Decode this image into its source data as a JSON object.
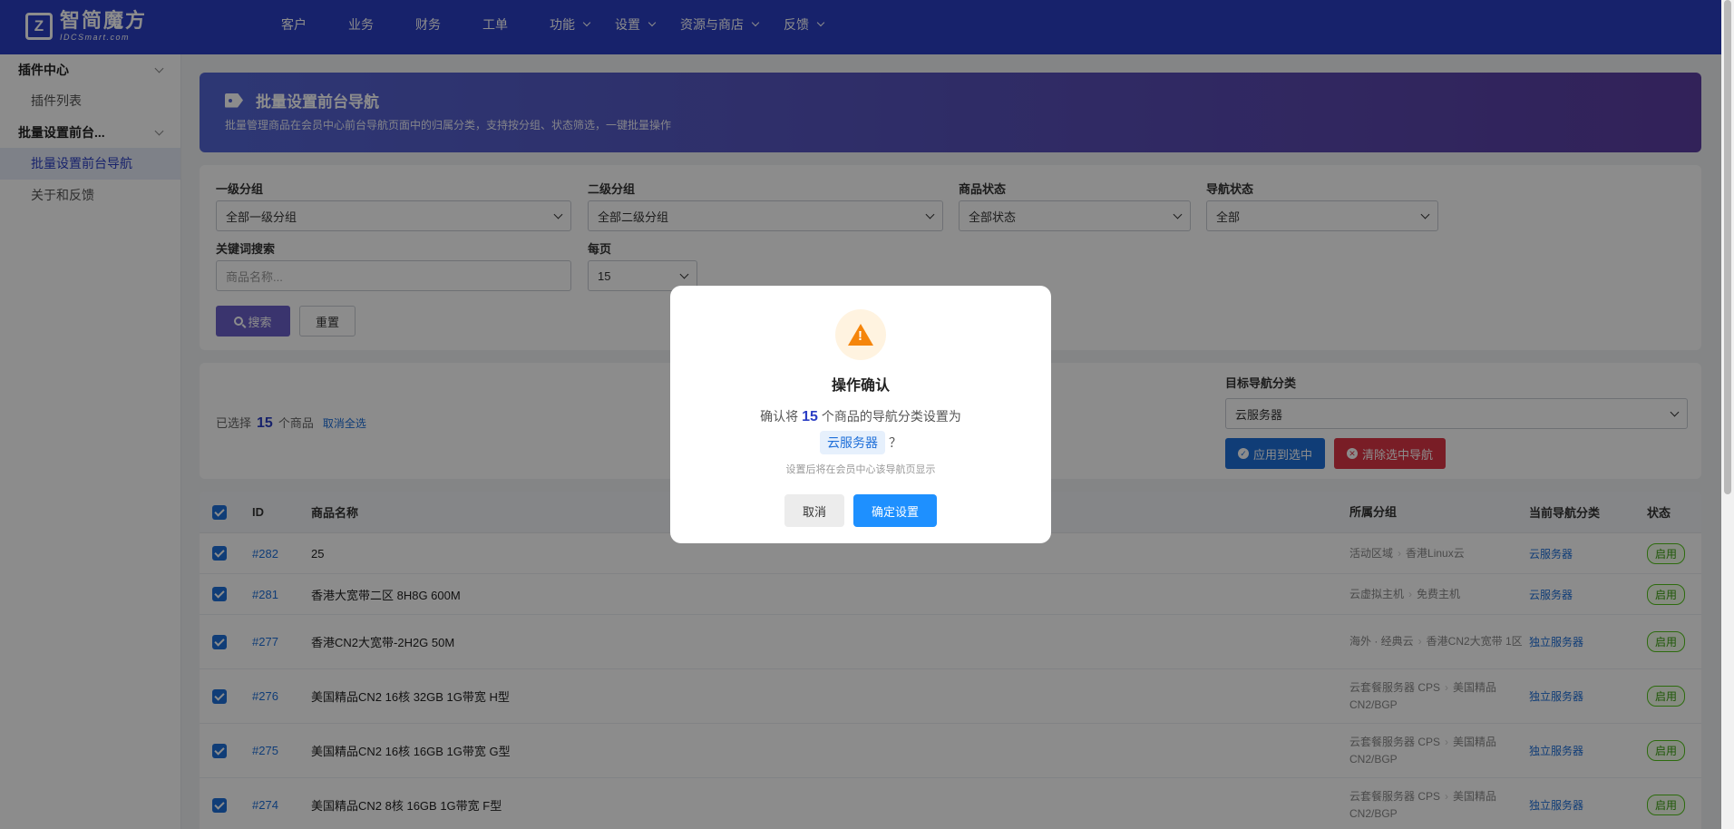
{
  "logo": {
    "mark": "Z",
    "main": "智简魔方",
    "sub": "IDCSmart.com"
  },
  "topnav": [
    {
      "label": "客户"
    },
    {
      "label": "业务"
    },
    {
      "label": "财务"
    },
    {
      "label": "工单"
    },
    {
      "label": "功能"
    },
    {
      "label": "设置"
    },
    {
      "label": "资源与商店"
    },
    {
      "label": "反馈"
    }
  ],
  "sidebar": {
    "group1": "插件中心",
    "item1": "插件列表",
    "group2": "批量设置前台...",
    "item2": "批量设置前台导航",
    "item3": "关于和反馈"
  },
  "banner": {
    "title": "批量设置前台导航",
    "desc": "批量管理商品在会员中心前台导航页面中的归属分类，支持按分组、状态筛选，一键批量操作"
  },
  "filter": {
    "group1_label": "一级分组",
    "group1_value": "全部一级分组",
    "group2_label": "二级分组",
    "group2_value": "全部二级分组",
    "status_label": "商品状态",
    "status_value": "全部状态",
    "nav_label": "导航状态",
    "nav_value": "全部",
    "keyword_label": "关键词搜索",
    "keyword_placeholder": "商品名称...",
    "perpage_label": "每页",
    "perpage_value": "15",
    "search_btn": "搜索",
    "reset_btn": "重置"
  },
  "batch": {
    "selected_prefix": "已选择",
    "selected_count": "15",
    "selected_suffix": "个商品",
    "deselect_all": "取消全选",
    "target_label": "目标导航分类",
    "target_value": "云服务器",
    "apply_btn": "应用到选中",
    "clear_btn": "清除选中导航"
  },
  "table": {
    "headers": {
      "id": "ID",
      "name": "商品名称",
      "group": "所属分组",
      "nav": "当前导航分类",
      "status": "状态"
    },
    "rows": [
      {
        "id": "#282",
        "name": "25",
        "group1": "活动区域",
        "group2": "香港Linux云",
        "nav": "云服务器",
        "status": "启用"
      },
      {
        "id": "#281",
        "name": "香港大宽带二区 8H8G 600M",
        "group1": "云虚拟主机",
        "group2": "免费主机",
        "nav": "云服务器",
        "status": "启用"
      },
      {
        "id": "#277",
        "name": "香港CN2大宽带-2H2G 50M",
        "group1": "海外 · 经典云",
        "group2": "香港CN2大宽带 1区",
        "nav": "独立服务器",
        "status": "启用"
      },
      {
        "id": "#276",
        "name": "美国精品CN2 16核 32GB 1G带宽 H型",
        "group1": "云套餐服务器 CPS",
        "group2": "美国精品CN2/BGP",
        "nav": "独立服务器",
        "status": "启用"
      },
      {
        "id": "#275",
        "name": "美国精品CN2 16核 16GB 1G带宽 G型",
        "group1": "云套餐服务器 CPS",
        "group2": "美国精品CN2/BGP",
        "nav": "独立服务器",
        "status": "启用"
      },
      {
        "id": "#274",
        "name": "美国精品CN2 8核 16GB 1G带宽 F型",
        "group1": "云套餐服务器 CPS",
        "group2": "美国精品CN2/BGP",
        "nav": "独立服务器",
        "status": "启用"
      }
    ]
  },
  "modal": {
    "title": "操作确认",
    "msg_prefix": "确认将",
    "count": "15",
    "msg_suffix": "个商品的导航分类设置为",
    "category": "云服务器",
    "question": "？",
    "hint": "设置后将在会员中心该导航页显示",
    "cancel": "取消",
    "confirm": "确定设置"
  },
  "colors": {
    "primary": "#2b3ec4",
    "link": "#1e6fd9",
    "danger": "#dc3545",
    "success": "#52c41a",
    "warning": "#f5850b"
  }
}
